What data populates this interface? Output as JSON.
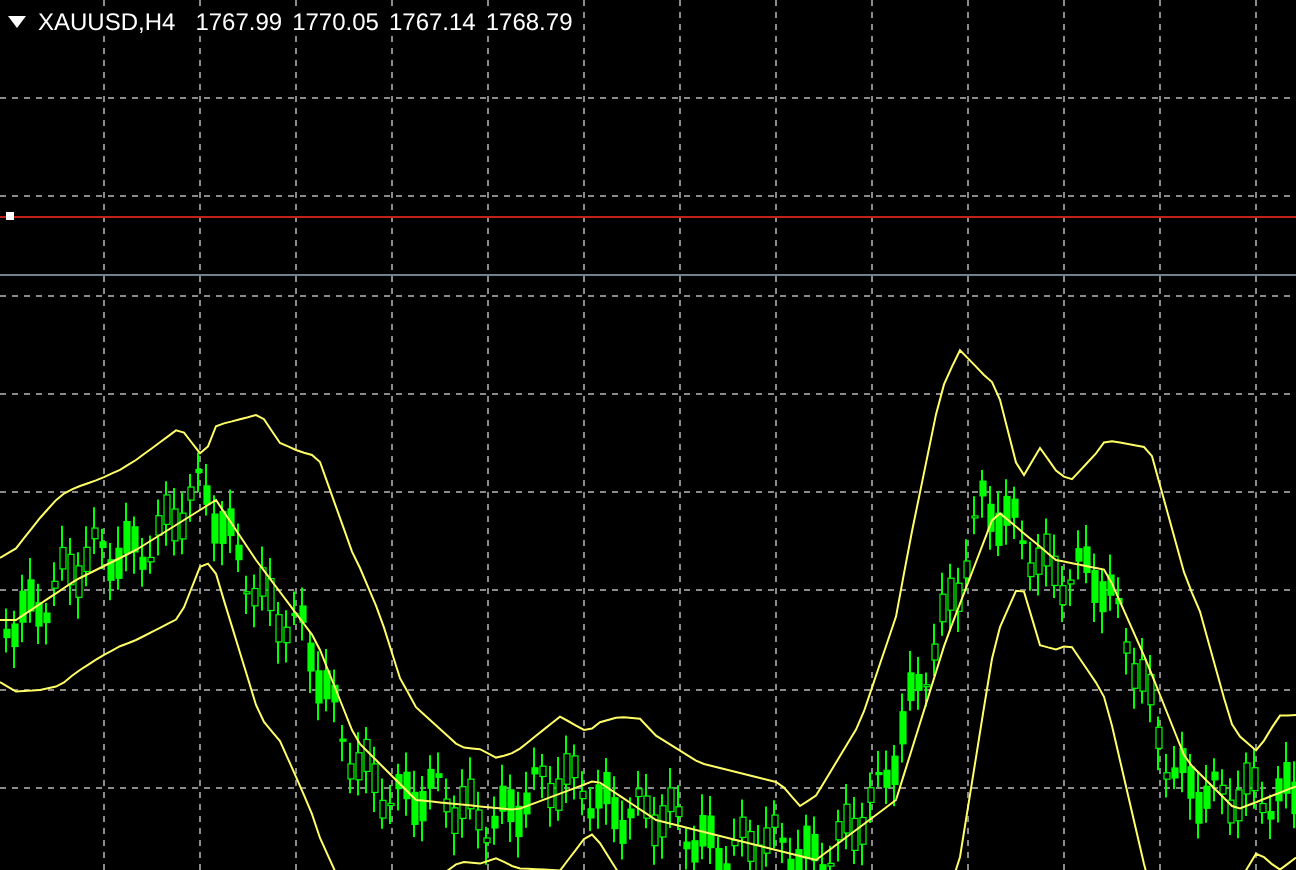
{
  "header": {
    "symbol": "XAUUSD,H4",
    "prices": [
      "1767.99",
      "1770.05",
      "1767.14",
      "1768.79"
    ]
  }
}
